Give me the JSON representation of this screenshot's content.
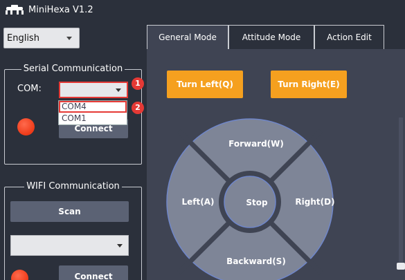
{
  "app": {
    "title": "MiniHexa V1.2"
  },
  "language": {
    "selected": "English"
  },
  "serial": {
    "legend": "Serial Communication",
    "com_label": "COM:",
    "selected": "",
    "options": [
      "COM4",
      "COM1"
    ],
    "connect_label": "Connect",
    "badge_1": "1",
    "badge_2": "2"
  },
  "wifi": {
    "legend": "WIFI Communication",
    "scan_label": "Scan",
    "selected": "",
    "connect_label": "Connect"
  },
  "tabs": [
    {
      "label": "General Mode",
      "active": true
    },
    {
      "label": "Attitude Mode",
      "active": false
    },
    {
      "label": "Action Edit",
      "active": false
    }
  ],
  "controls": {
    "turn_left": "Turn Left(Q)",
    "turn_right": "Turn Right(E)",
    "forward": "Forward(W)",
    "left": "Left(A)",
    "right": "Right(D)",
    "backward": "Backward(S)",
    "stop": "Stop"
  },
  "colors": {
    "background": "#2b303b",
    "panel": "#3f4453",
    "accent_orange": "#f5a01f",
    "dpad": "#7e8597",
    "dpad_outline": "#6f86c9",
    "status_red": "#ee3a18",
    "highlight_red": "#e53935"
  }
}
